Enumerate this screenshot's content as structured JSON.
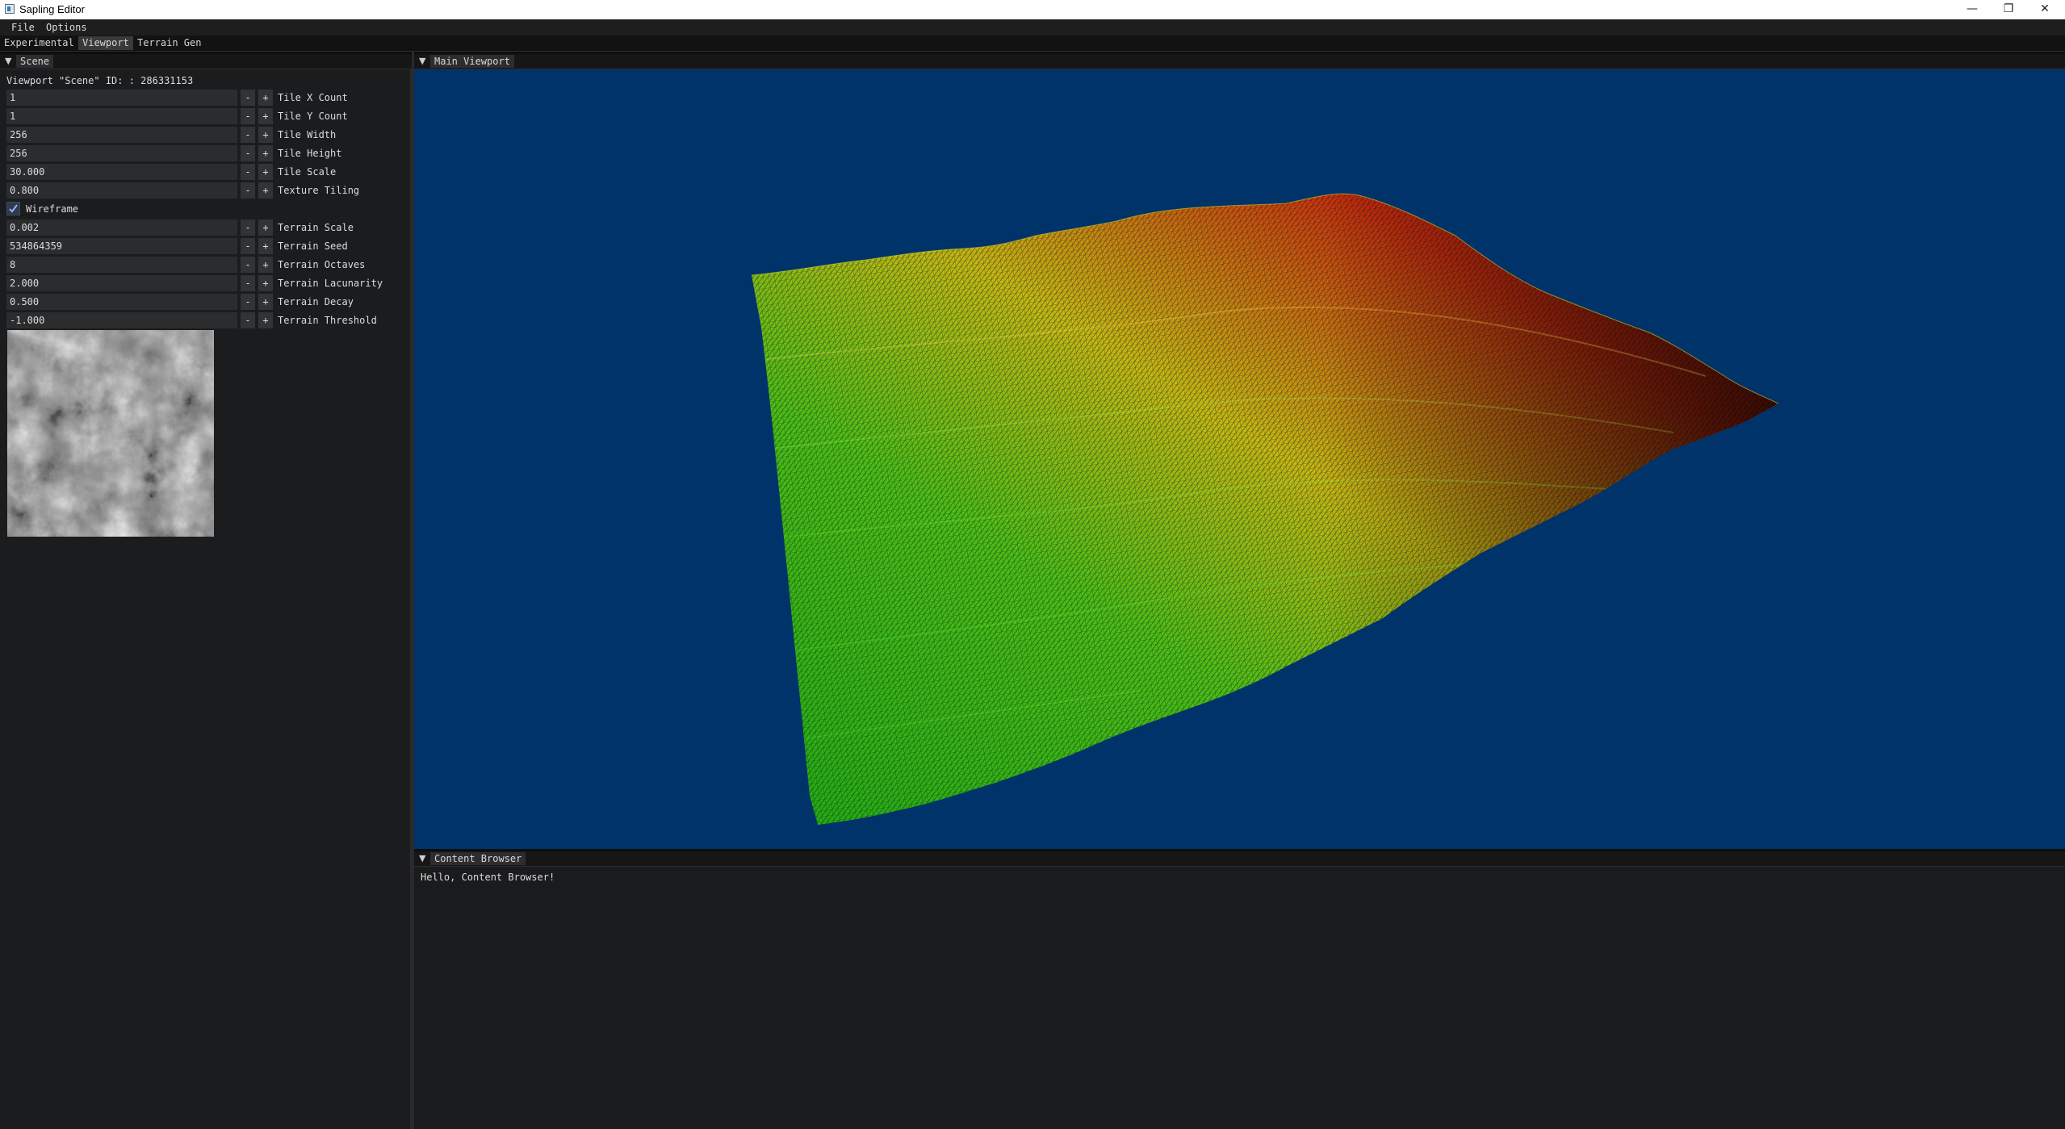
{
  "window": {
    "title": "Sapling Editor",
    "minimize_glyph": "—",
    "restore_glyph": "❐",
    "close_glyph": "✕"
  },
  "menubar": {
    "items": [
      "File",
      "Options"
    ]
  },
  "tabs": {
    "items": [
      "Experimental",
      "Viewport",
      "Terrain Gen"
    ],
    "active": "Viewport"
  },
  "scene_panel": {
    "title": "Scene",
    "viewport_info": "Viewport \"Scene\" ID: : 286331153",
    "minus": "-",
    "plus": "+",
    "fields": [
      {
        "value": "1",
        "label": "Tile X Count"
      },
      {
        "value": "1",
        "label": "Tile Y Count"
      },
      {
        "value": "256",
        "label": "Tile Width"
      },
      {
        "value": "256",
        "label": "Tile Height"
      },
      {
        "value": "30.000",
        "label": "Tile Scale"
      },
      {
        "value": "0.800",
        "label": "Texture Tiling"
      }
    ],
    "wireframe": {
      "label": "Wireframe",
      "checked": true
    },
    "terrain_fields": [
      {
        "value": "0.002",
        "label": "Terrain Scale"
      },
      {
        "value": "534864359",
        "label": "Terrain Seed"
      },
      {
        "value": "8",
        "label": "Terrain Octaves"
      },
      {
        "value": "2.000",
        "label": "Terrain Lacunarity"
      },
      {
        "value": "0.500",
        "label": "Terrain Decay"
      },
      {
        "value": "-1.000",
        "label": "Terrain Threshold"
      }
    ]
  },
  "main_viewport": {
    "title": "Main Viewport",
    "background": "#00336a"
  },
  "content_browser": {
    "title": "Content Browser",
    "message": "Hello, Content Browser!"
  },
  "colors": {
    "mesh_low": "#1fae12",
    "mesh_mid": "#c8c010",
    "mesh_high": "#cc1a0a",
    "mesh_far": "#1a2a22",
    "checkbox_accent": "#2f6fd6"
  }
}
